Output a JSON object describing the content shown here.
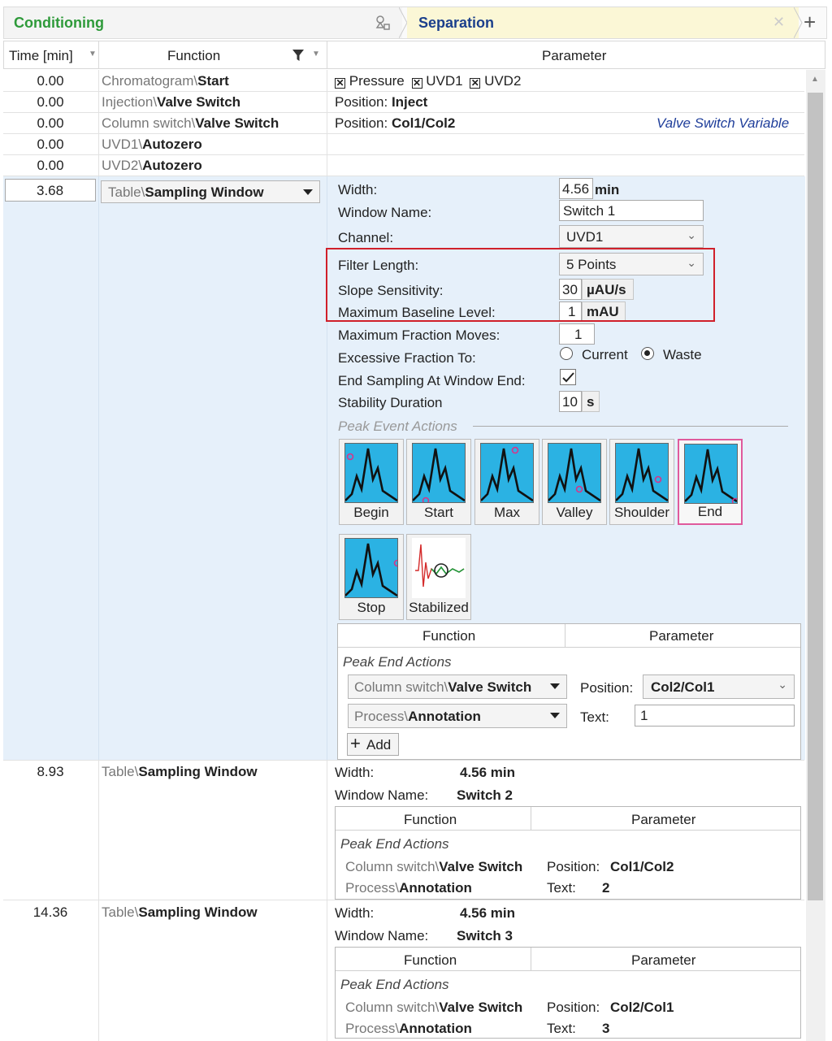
{
  "tabs": {
    "conditioning": "Conditioning",
    "separation": "Separation",
    "add_label": "+",
    "close_label": "✕"
  },
  "columns": {
    "time": "Time [min]",
    "function": "Function",
    "parameter": "Parameter"
  },
  "rows": [
    {
      "time": "0.00",
      "fn_prefix": "Chromatogram\\",
      "fn_bold": "Start"
    },
    {
      "time": "0.00",
      "fn_prefix": "Injection\\",
      "fn_bold": "Valve Switch",
      "param_label": "Position:",
      "param_value": "Inject"
    },
    {
      "time": "0.00",
      "fn_prefix": "Column switch\\",
      "fn_bold": "Valve Switch",
      "param_label": "Position:",
      "param_value": "Col1/Col2",
      "param_link": "Valve Switch Variable"
    },
    {
      "time": "0.00",
      "fn_prefix": "UVD1\\",
      "fn_bold": "Autozero"
    },
    {
      "time": "0.00",
      "fn_prefix": "UVD2\\",
      "fn_bold": "Autozero"
    }
  ],
  "row0_checks": [
    "Pressure",
    "UVD1",
    "UVD2"
  ],
  "selected": {
    "time": "3.68",
    "fn_prefix": "Table\\",
    "fn_bold": "Sampling Window",
    "width_label": "Width:",
    "width_value": "4.56",
    "width_unit": "min",
    "window_name_label": "Window Name:",
    "window_name_value": "Switch 1",
    "channel_label": "Channel:",
    "channel_value": "UVD1",
    "filter_length_label": "Filter Length:",
    "filter_length_value": "5 Points",
    "slope_label": "Slope Sensitivity:",
    "slope_value": "30",
    "slope_unit": "µAU/s",
    "max_baseline_label": "Maximum Baseline Level:",
    "max_baseline_value": "1",
    "max_baseline_unit": "mAU",
    "max_moves_label": "Maximum Fraction Moves:",
    "max_moves_value": "1",
    "excessive_label": "Excessive Fraction To:",
    "excessive_opt1": "Current",
    "excessive_opt2": "Waste",
    "end_sampling_label": "End Sampling At Window End:",
    "end_sampling_checked": true,
    "stability_label": "Stability Duration",
    "stability_value": "10",
    "stability_unit": "s",
    "peak_event_label": "Peak Event Actions",
    "peak_buttons": [
      "Begin",
      "Start",
      "Max",
      "Valley",
      "Shoulder",
      "End",
      "Stop",
      "Stabilized"
    ],
    "sub_fn_header": "Function",
    "sub_param_header": "Parameter",
    "peak_end_actions": "Peak End Actions",
    "action1_prefix": "Column switch\\",
    "action1_bold": "Valve Switch",
    "action1_param_label": "Position:",
    "action1_param_value": "Col2/Col1",
    "action2_prefix": "Process\\",
    "action2_bold": "Annotation",
    "action2_param_label": "Text:",
    "action2_param_value": "1",
    "add_label": "Add"
  },
  "windows": [
    {
      "time": "8.93",
      "fn_prefix": "Table\\",
      "fn_bold": "Sampling Window",
      "width_label": "Width:",
      "width_value": "4.56 min",
      "name_label": "Window Name:",
      "name_value": "Switch 2",
      "fn_header": "Function",
      "param_header": "Parameter",
      "peak_end": "Peak End Actions",
      "a1_prefix": "Column switch\\",
      "a1_bold": "Valve Switch",
      "a1_label": "Position:",
      "a1_value": "Col1/Col2",
      "a2_prefix": "Process\\",
      "a2_bold": "Annotation",
      "a2_label": "Text:",
      "a2_value": "2"
    },
    {
      "time": "14.36",
      "fn_prefix": "Table\\",
      "fn_bold": "Sampling Window",
      "width_label": "Width:",
      "width_value": "4.56 min",
      "name_label": "Window Name:",
      "name_value": "Switch 3",
      "fn_header": "Function",
      "param_header": "Parameter",
      "peak_end": "Peak End Actions",
      "a1_prefix": "Column switch\\",
      "a1_bold": "Valve Switch",
      "a1_label": "Position:",
      "a1_value": "Col2/Col1",
      "a2_prefix": "Process\\",
      "a2_bold": "Annotation",
      "a2_label": "Text:",
      "a2_value": "3"
    }
  ],
  "colors": {
    "accent_green": "#2e9a3a",
    "tab_blue": "#1b3f8c",
    "selection_bg": "#e6f0fa",
    "highlight_red": "#d0202a",
    "peak_blue": "#2bb2e3"
  }
}
